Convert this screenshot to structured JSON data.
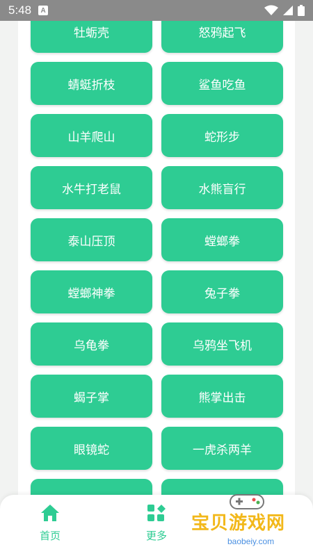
{
  "status": {
    "time": "5:48",
    "notif_badge": "A"
  },
  "buttons": [
    "牡蛎壳",
    "怒鸦起飞",
    "蜻蜓折枝",
    "鲨鱼吃鱼",
    "山羊爬山",
    "蛇形步",
    "水牛打老鼠",
    "水熊盲行",
    "泰山压顶",
    "螳螂拳",
    "螳螂神拳",
    "兔子拳",
    "乌龟拳",
    "乌鸦坐飞机",
    "蝎子掌",
    "熊掌出击",
    "眼镜蛇",
    "一虎杀两羊"
  ],
  "nav": {
    "home": {
      "label": "首页",
      "icon": "home-icon"
    },
    "more": {
      "label": "更多",
      "icon": "more-icon"
    }
  },
  "watermark": {
    "text": "宝贝游戏网",
    "url": "baobeiy.com"
  },
  "colors": {
    "accent": "#2ecc93",
    "status_bar": "#8a8a8a",
    "watermark": "#f2b81a"
  }
}
